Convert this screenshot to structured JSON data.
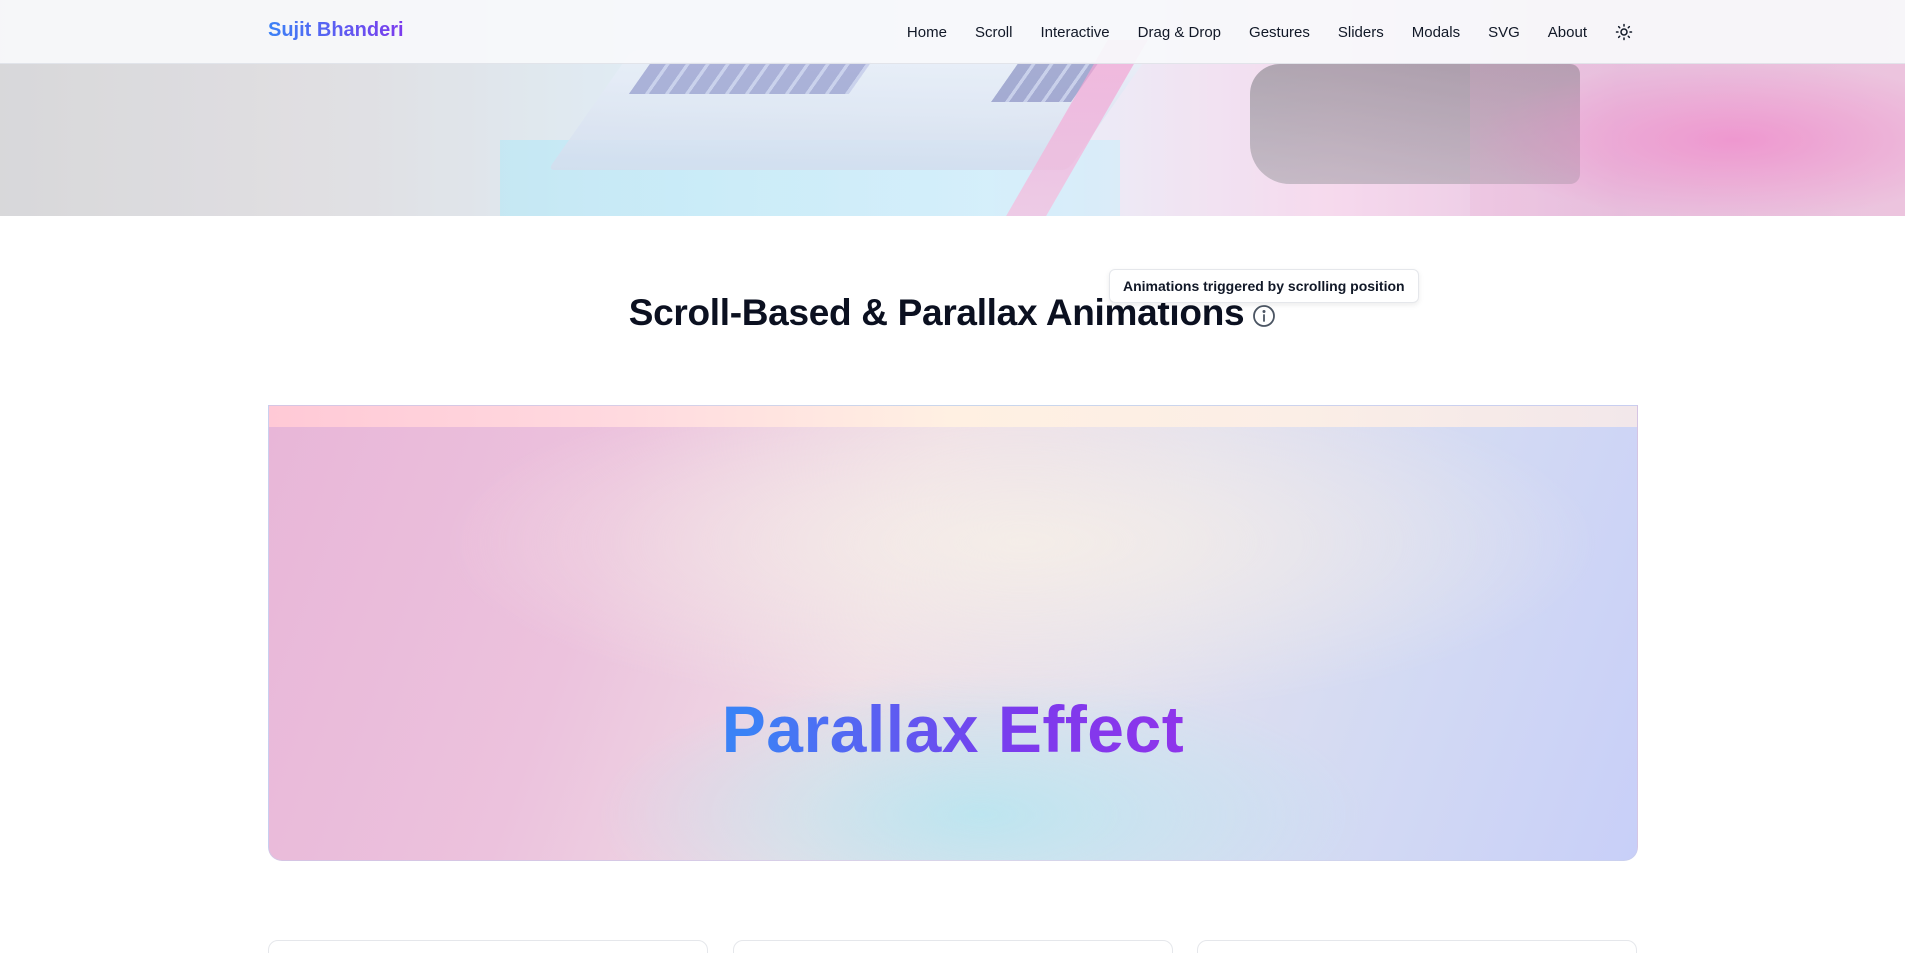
{
  "navbar": {
    "brand": "Sujit Bhanderi",
    "links": [
      "Home",
      "Scroll",
      "Interactive",
      "Drag & Drop",
      "Gestures",
      "Sliders",
      "Modals",
      "SVG",
      "About"
    ],
    "theme_toggle_icon": "sun-icon"
  },
  "section": {
    "title": "Scroll-Based & Parallax Animations",
    "info_icon": "info-icon",
    "tooltip": "Animations triggered by scrolling position"
  },
  "parallax": {
    "title": "Parallax Effect"
  },
  "colors": {
    "brand_gradient_start": "#3b82f6",
    "brand_gradient_end": "#7c3aed"
  }
}
